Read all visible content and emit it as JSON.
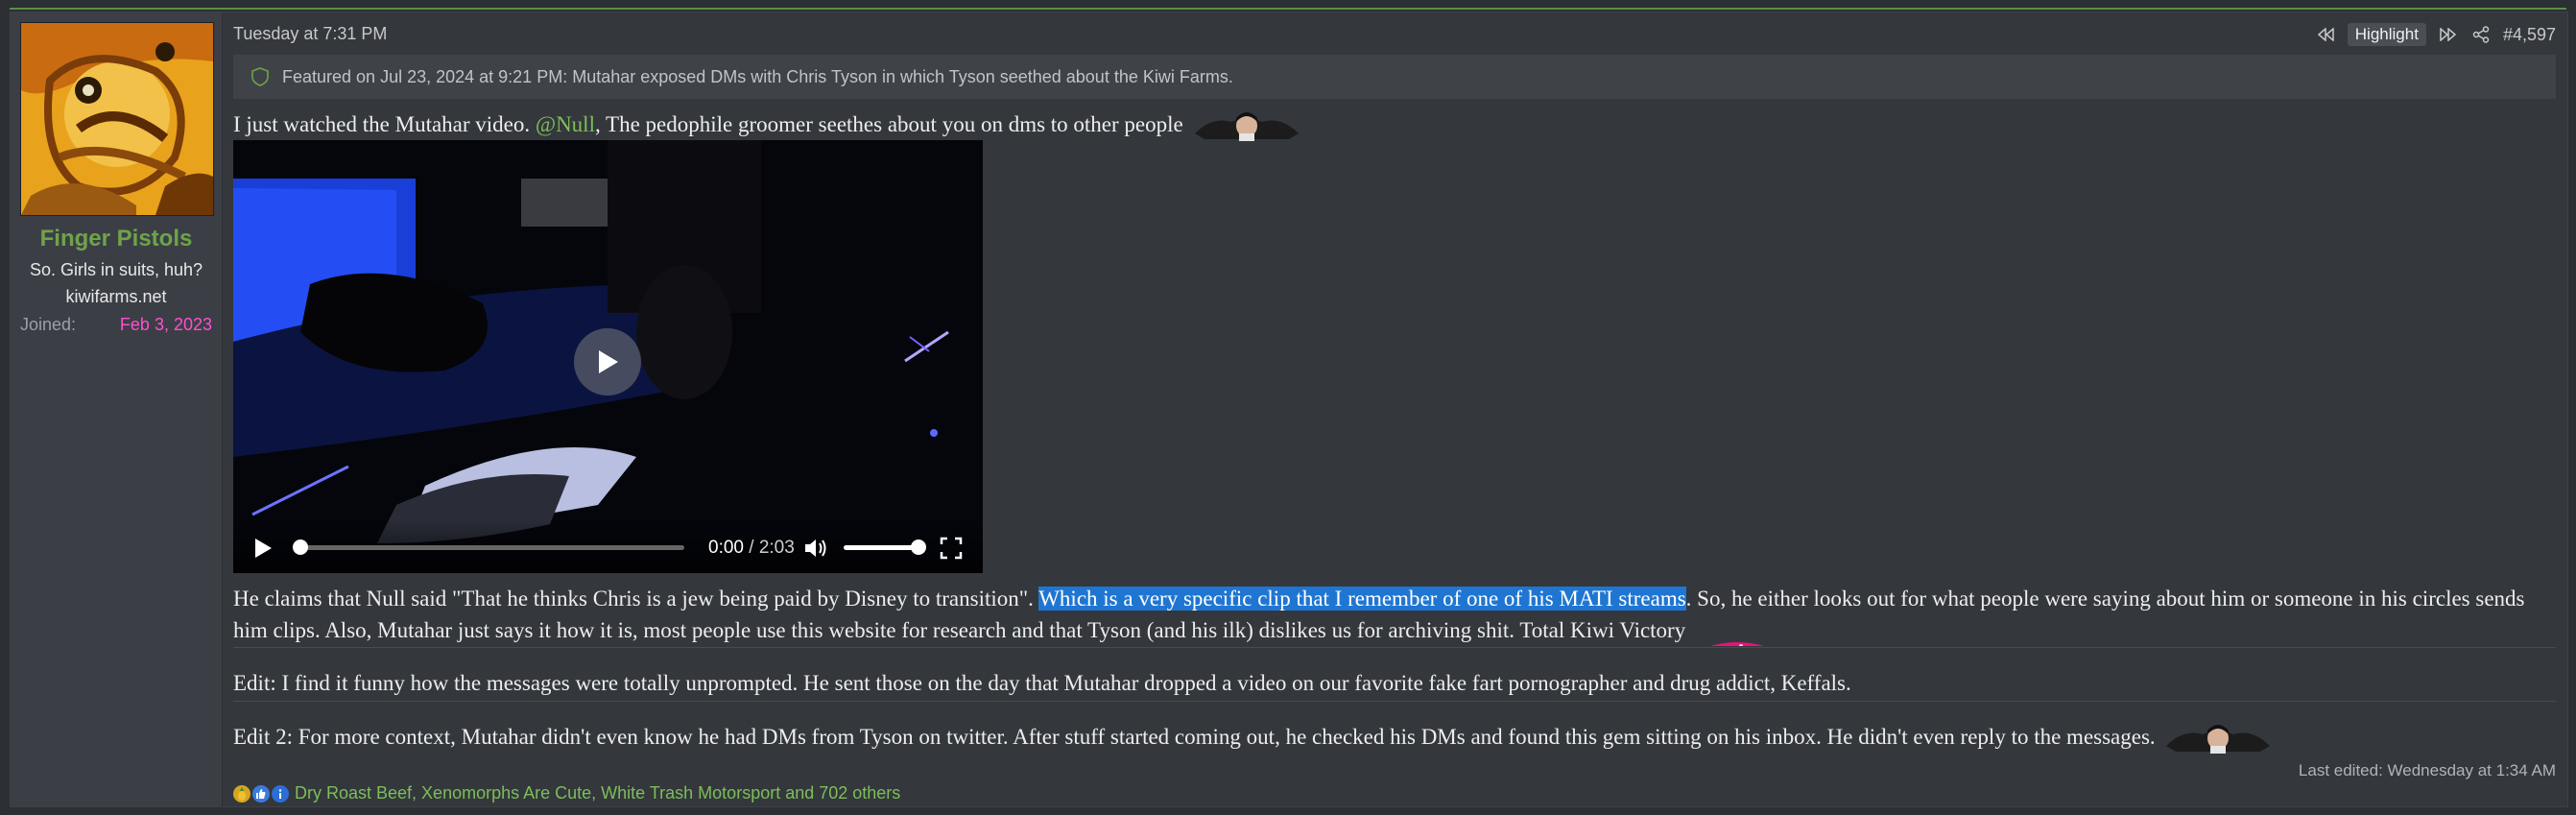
{
  "user": {
    "name": "Finger Pistols",
    "title": "So. Girls in suits, huh?",
    "banner": "kiwifarms.net",
    "joined_label": "Joined:",
    "joined_value": "Feb 3, 2023"
  },
  "post": {
    "date": "Tuesday at 7:31 PM",
    "highlight_label": "Highlight",
    "number": "#4,597",
    "featured": "Featured on Jul 23, 2024 at 9:21 PM: Mutahar exposed DMs with Chris Tyson in which Tyson seethed about the Kiwi Farms.",
    "p1_before": "I just watched the Mutahar video. ",
    "p1_mention": "@Null",
    "p1_after": ", The pedophile groomer seethes about you on dms to other people",
    "video": {
      "current_time": "0:00",
      "duration": "/ 2:03",
      "progress": 0,
      "volume": 1.0
    },
    "p2_before": "He claims that Null said \"That he thinks Chris is a jew being paid by Disney to transition\". ",
    "p2_selected": "Which is a very specific clip that I remember of one of his MATI streams",
    "p2_after": ". So, he either looks out for what people were saying about him or someone in his circles sends him clips. Also, Mutahar just says it how it is, most people use this website for research and that Tyson (and his ilk) dislikes us for archiving shit. Total Kiwi Victory",
    "p3": "Edit: I find it funny how the messages were totally unprompted. He sent those on the day that Mutahar dropped a video on our favorite fake fart pornographer and drug addict, Keffals.",
    "p4": "Edit 2: For more context, Mutahar didn't even know he had DMs from Tyson on twitter. After stuff started coming out, he checked his DMs and found this gem sitting on his inbox. He didn't even reply to the messages.",
    "last_edited": "Last edited: Wednesday at 1:34 AM",
    "reactions": "Dry Roast Beef, Xenomorphs Are Cute, White Trash Motorsport and 702 others"
  },
  "colors": {
    "accent_green": "#6fa34a",
    "joined_pink": "#ff4fd0",
    "selection_blue": "#1f76d2"
  }
}
